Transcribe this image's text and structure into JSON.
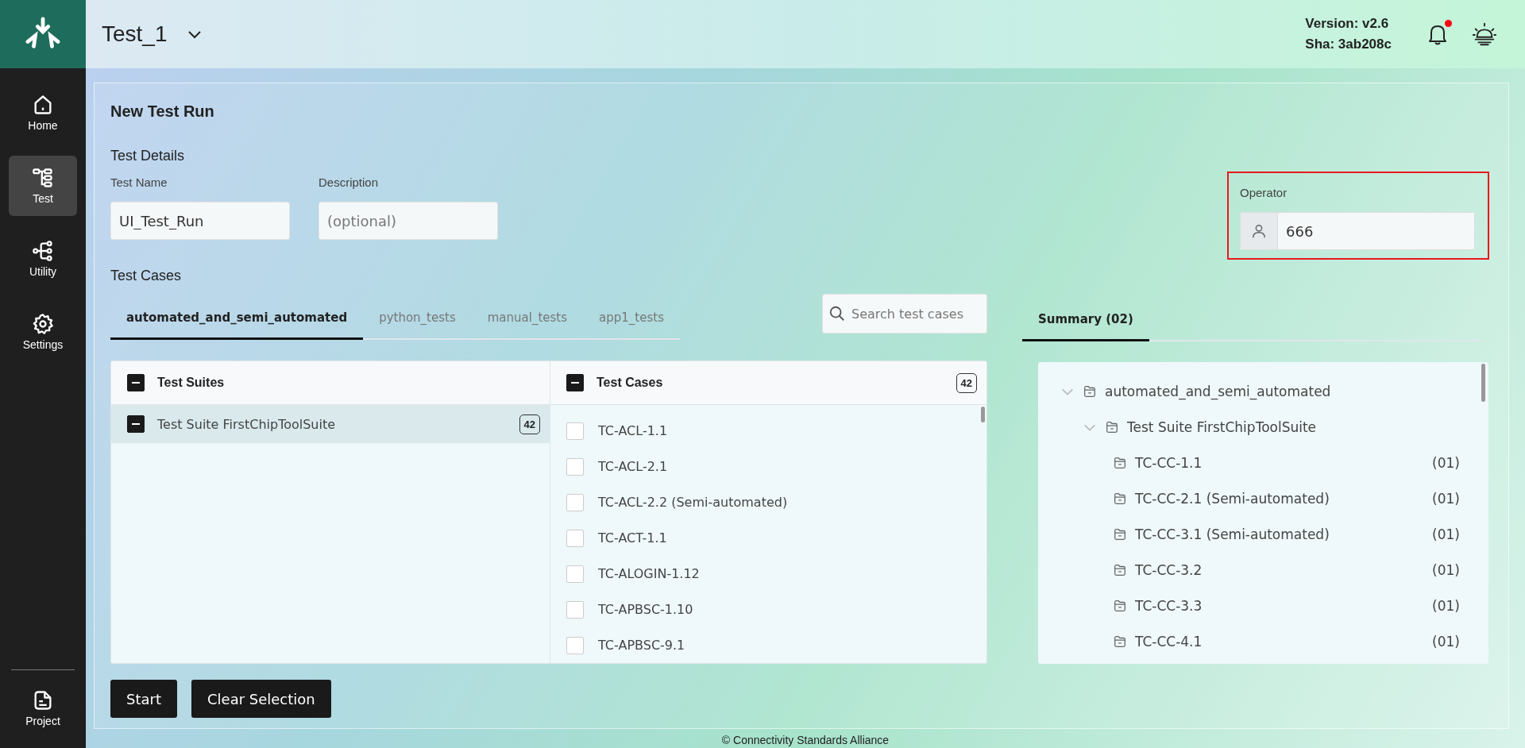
{
  "app": {
    "project": "Test_1",
    "version": "Version: v2.6",
    "sha": "Sha: 3ab208c",
    "notification_unread": true
  },
  "sidebar": {
    "items": [
      {
        "label": "Home",
        "selected": false
      },
      {
        "label": "Test",
        "selected": true
      },
      {
        "label": "Utility",
        "selected": false
      },
      {
        "label": "Settings",
        "selected": false
      }
    ],
    "footer_item": {
      "label": "Project",
      "selected": false
    }
  },
  "page": {
    "title": "New Test Run"
  },
  "test_details": {
    "heading": "Test Details",
    "fields": [
      {
        "label": "Test Name",
        "value": "UI_Test_Run"
      },
      {
        "label": "Description",
        "placeholder": "(optional)"
      }
    ],
    "operator": {
      "label": "Operator",
      "value": "666",
      "highlighted": true
    }
  },
  "test_cases": {
    "heading": "Test Cases",
    "tabs": [
      {
        "label": "automated_and_semi_automated",
        "selected": true
      },
      {
        "label": "python_tests",
        "selected": false
      },
      {
        "label": "manual_tests",
        "selected": false
      },
      {
        "label": "app1_tests",
        "selected": false
      }
    ],
    "search": {
      "placeholder": "Search test cases"
    },
    "suites_column": {
      "title": "Test Suites",
      "indeterminate": true
    },
    "suites": [
      {
        "name": "Test Suite FirstChipToolSuite",
        "count": "42",
        "indeterminate": true,
        "selected": true
      }
    ],
    "cases_column": {
      "title": "Test Cases",
      "indeterminate": true,
      "count": "42"
    },
    "cases": [
      {
        "name": "TC-ACL-1.1",
        "checked": false
      },
      {
        "name": "TC-ACL-2.1",
        "checked": false
      },
      {
        "name": "TC-ACL-2.2 (Semi-automated)",
        "checked": false
      },
      {
        "name": "TC-ACT-1.1",
        "checked": false
      },
      {
        "name": "TC-ALOGIN-1.12",
        "checked": false
      },
      {
        "name": "TC-APBSC-1.10",
        "checked": false
      },
      {
        "name": "TC-APBSC-9.1",
        "checked": false
      }
    ]
  },
  "summary": {
    "tab": {
      "label": "Summary (02)",
      "selected": true
    },
    "tree": [
      {
        "label": "automated_and_semi_automated",
        "expanded": true,
        "children": [
          {
            "label": "Test Suite FirstChipToolSuite",
            "expanded": true,
            "children": [
              {
                "label": "TC-CC-1.1",
                "count": "(01)"
              },
              {
                "label": "TC-CC-2.1 (Semi-automated)",
                "count": "(01)"
              },
              {
                "label": "TC-CC-3.1 (Semi-automated)",
                "count": "(01)"
              },
              {
                "label": "TC-CC-3.2",
                "count": "(01)"
              },
              {
                "label": "TC-CC-3.3",
                "count": "(01)"
              },
              {
                "label": "TC-CC-4.1",
                "count": "(01)"
              }
            ]
          }
        ]
      }
    ]
  },
  "buttons": [
    {
      "label": "Start"
    },
    {
      "label": "Clear Selection"
    }
  ],
  "footer": {
    "text": "© Connectivity Standards Alliance"
  }
}
